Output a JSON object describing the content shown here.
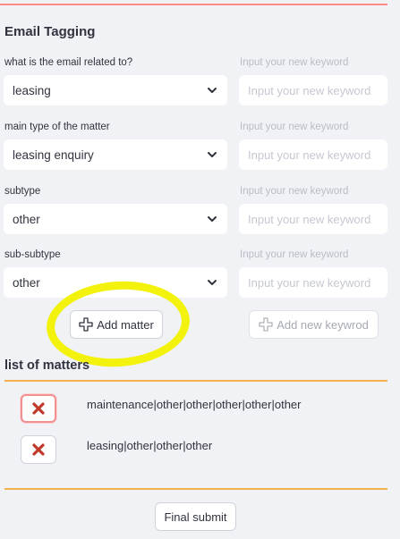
{
  "form": {
    "title": "Email Tagging",
    "rows": [
      {
        "label": "what is the email related to?",
        "value": "leasing",
        "keyword_label": "Input your new keyword",
        "keyword_placeholder": "Input your new keyword"
      },
      {
        "label": "main type of the matter",
        "value": "leasing enquiry",
        "keyword_label": "Input your new keyword",
        "keyword_placeholder": "Input your new keyword"
      },
      {
        "label": "subtype",
        "value": "other",
        "keyword_label": "Input your new keyword",
        "keyword_placeholder": "Input your new keyword"
      },
      {
        "label": "sub-subtype",
        "value": "other",
        "keyword_label": "Input your new keyword",
        "keyword_placeholder": "Input your new keyword"
      }
    ],
    "add_matter_label": "Add matter",
    "add_keyword_label": "Add new keywrod"
  },
  "matters": {
    "title": "list of matters",
    "items": [
      {
        "text": "maintenance|other|other|other|other|other"
      },
      {
        "text": "leasing|other|other|other"
      }
    ]
  },
  "final_submit_label": "Final submit",
  "colors": {
    "accent_rule": "#ff8a8a",
    "section_rule": "#f6b04e",
    "highlight": "#f2f20c",
    "delete_icon": "#c0392b",
    "primary_text": "#31333f"
  }
}
